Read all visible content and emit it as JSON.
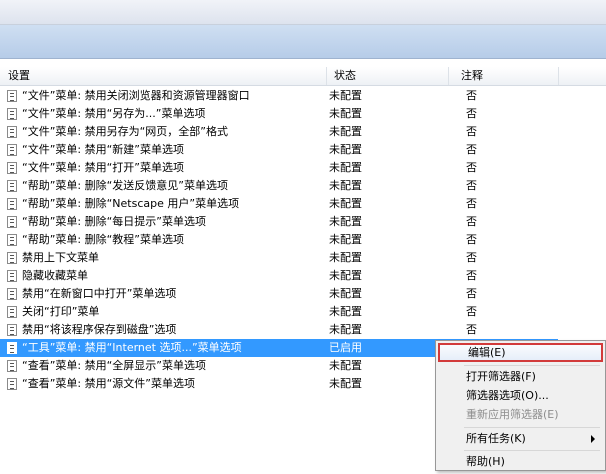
{
  "columns": {
    "setting": "设置",
    "status": "状态",
    "comment": "注释"
  },
  "rows": [
    {
      "setting": "“文件”菜单: 禁用关闭浏览器和资源管理器窗口",
      "status": "未配置",
      "comment": "否",
      "icon": "policy-icon"
    },
    {
      "setting": "“文件”菜单: 禁用“另存为...”菜单选项",
      "status": "未配置",
      "comment": "否",
      "icon": "policy-icon"
    },
    {
      "setting": "“文件”菜单: 禁用另存为“网页，全部”格式",
      "status": "未配置",
      "comment": "否",
      "icon": "policy-icon"
    },
    {
      "setting": "“文件”菜单: 禁用“新建”菜单选项",
      "status": "未配置",
      "comment": "否",
      "icon": "policy-icon"
    },
    {
      "setting": "“文件”菜单: 禁用“打开”菜单选项",
      "status": "未配置",
      "comment": "否",
      "icon": "policy-icon"
    },
    {
      "setting": "“帮助”菜单: 删除“发送反馈意见”菜单选项",
      "status": "未配置",
      "comment": "否",
      "icon": "policy-icon"
    },
    {
      "setting": "“帮助”菜单: 删除“Netscape 用户”菜单选项",
      "status": "未配置",
      "comment": "否",
      "icon": "policy-icon"
    },
    {
      "setting": "“帮助”菜单: 删除“每日提示”菜单选项",
      "status": "未配置",
      "comment": "否",
      "icon": "policy-icon"
    },
    {
      "setting": "“帮助”菜单: 删除“教程”菜单选项",
      "status": "未配置",
      "comment": "否",
      "icon": "policy-icon"
    },
    {
      "setting": "禁用上下文菜单",
      "status": "未配置",
      "comment": "否",
      "icon": "policy-icon"
    },
    {
      "setting": "隐藏收藏菜单",
      "status": "未配置",
      "comment": "否",
      "icon": "policy-icon"
    },
    {
      "setting": "禁用“在新窗口中打开”菜单选项",
      "status": "未配置",
      "comment": "否",
      "icon": "policy-icon"
    },
    {
      "setting": "关闭“打印”菜单",
      "status": "未配置",
      "comment": "否",
      "icon": "policy-icon"
    },
    {
      "setting": "禁用“将该程序保存到磁盘”选项",
      "status": "未配置",
      "comment": "否",
      "icon": "policy-icon"
    },
    {
      "setting": "“工具”菜单: 禁用“Internet 选项...”菜单选项",
      "status": "已启用",
      "comment": "",
      "icon": "policy-icon",
      "selected": true
    },
    {
      "setting": "“查看”菜单: 禁用“全屏显示”菜单选项",
      "status": "未配置",
      "comment": "",
      "icon": "policy-icon"
    },
    {
      "setting": "“查看”菜单: 禁用“源文件”菜单选项",
      "status": "未配置",
      "comment": "",
      "icon": "policy-icon"
    }
  ],
  "context_menu": {
    "edit": "编辑(E)",
    "open_filter": "打开筛选器(F)",
    "filter_options": "筛选器选项(O)...",
    "reapply_filter": "重新应用筛选器(E)",
    "all_tasks": "所有任务(K)",
    "help": "帮助(H)"
  },
  "colors": {
    "selection": "#3399ff",
    "highlight_border": "#d23a3a"
  }
}
